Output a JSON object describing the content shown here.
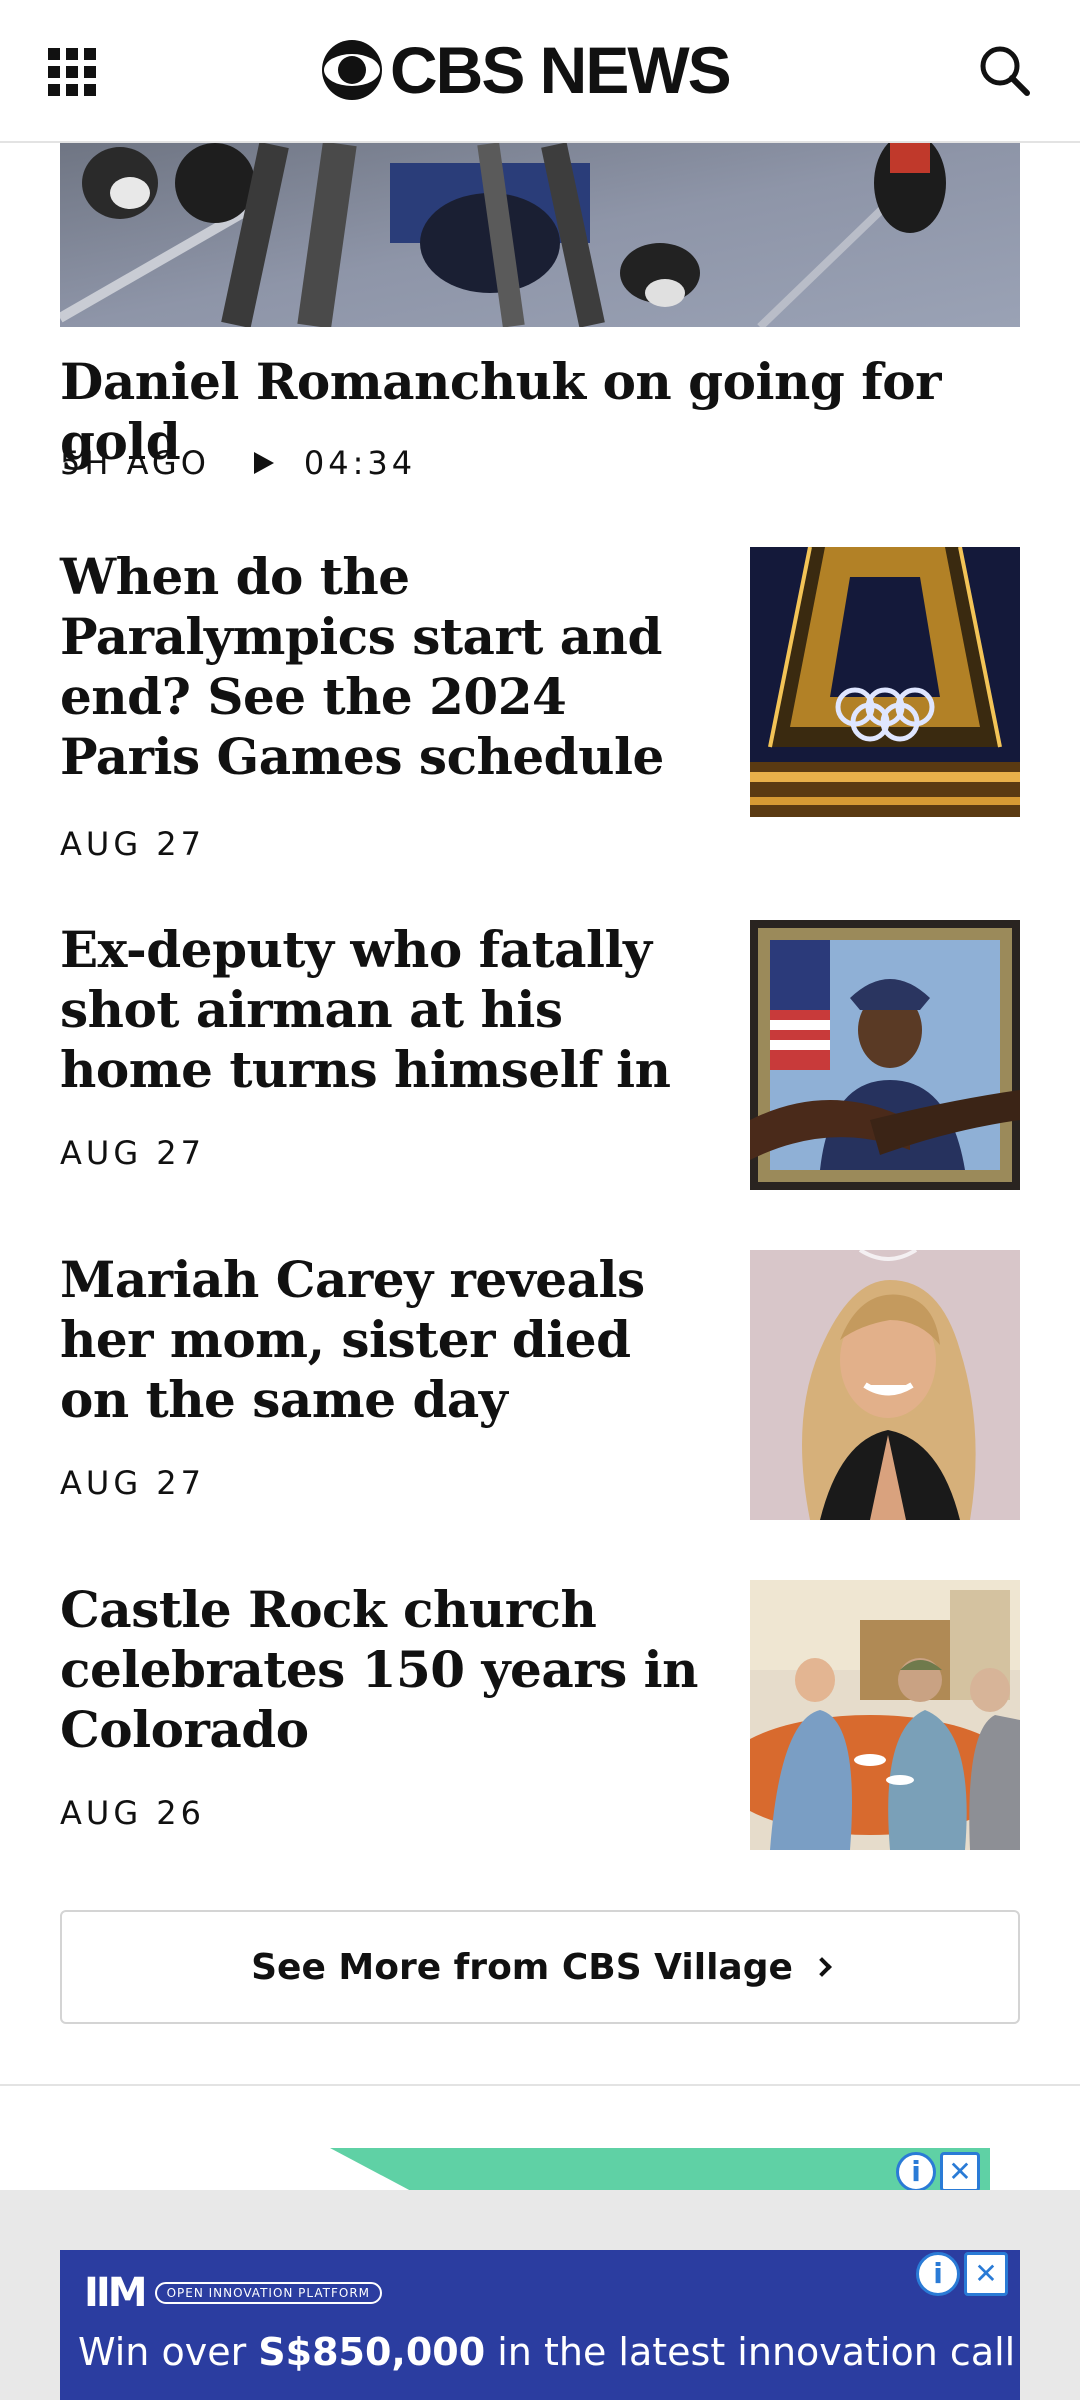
{
  "header": {
    "logo_text": "CBS NEWS",
    "menu_icon": "grid-menu-icon",
    "search_icon": "search-icon"
  },
  "hero": {
    "title": "Daniel Romanchuk on going for gold",
    "time": "5H AGO",
    "duration": "04:34"
  },
  "articles": [
    {
      "title": "When do the Paralympics start and end? See the 2024 Paris Games schedule",
      "date": "AUG 27"
    },
    {
      "title": "Ex-deputy who fatally shot airman at his home turns himself in",
      "date": "AUG 27"
    },
    {
      "title": "Mariah Carey reveals her mom, sister died on the same day",
      "date": "AUG 27"
    },
    {
      "title": "Castle Rock church celebrates 150 years in Colorado",
      "date": "AUG 26"
    }
  ],
  "more_button": {
    "label": "See More from CBS Village"
  },
  "ad": {
    "brand": "IIM",
    "pill": "OPEN INNOVATION PLATFORM",
    "headline_pre": "Win over ",
    "headline_amount": "S$850,000",
    "headline_post": " in the latest innovation call!",
    "info_glyph": "i",
    "close_glyph": "✕"
  },
  "colors": {
    "text": "#111111",
    "divider": "#e3e3e3",
    "ad_blue": "#2b3da0",
    "ad_green": "#5fd1a5",
    "ad_control": "#2a7bd6"
  }
}
